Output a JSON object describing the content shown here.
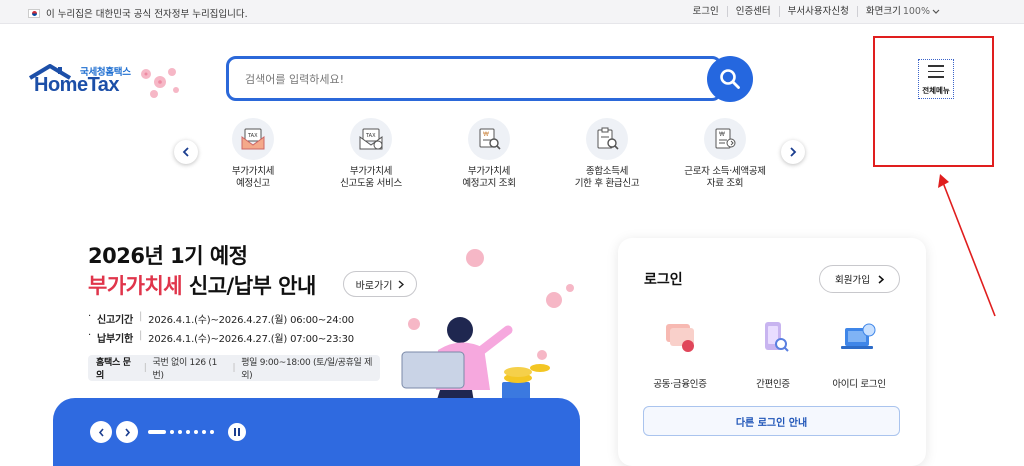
{
  "topbar": {
    "notice": "이 누리집은 대한민국 공식 전자정부 누리집입니다.",
    "links": [
      "로그인",
      "인증센터",
      "부서사용자신청"
    ],
    "zoom_label": "화면크기",
    "zoom_value": "100%"
  },
  "logo": {
    "sub": "국세청홈택스",
    "main": "HomeTax"
  },
  "search": {
    "placeholder": "검색어를 입력하세요!"
  },
  "menu": {
    "label": "전체메뉴"
  },
  "quick_menu": [
    {
      "line1": "부가가치세",
      "line2": "예정신고",
      "icon": "tax-envelope-icon"
    },
    {
      "line1": "부가가치세",
      "line2": "신고도움 서비스",
      "icon": "tax-help-icon"
    },
    {
      "line1": "부가가치세",
      "line2": "예정고지 조회",
      "icon": "notice-search-icon"
    },
    {
      "line1": "종합소득세",
      "line2": "기한 후 환급신고",
      "icon": "clipboard-search-icon"
    },
    {
      "line1": "근로자 소득·세액공제",
      "line2": "자료 조회",
      "icon": "document-won-icon"
    }
  ],
  "banner": {
    "title_line1": "2026년 1기 예정",
    "title_highlight": "부가가치세",
    "title_rest": " 신고/납부 안내",
    "shortcut_label": "바로가기",
    "periods": [
      {
        "label": "신고기간",
        "value": "2026.4.1.(수)~2026.4.27.(월) 06:00~24:00"
      },
      {
        "label": "납부기한",
        "value": "2026.4.1.(수)~2026.4.27.(월) 07:00~23:30"
      }
    ],
    "inquiry_label": "홈택스 문의",
    "inquiry_phone": "국번 없이 126 (1번)",
    "inquiry_hours": "평일 9:00~18:00 (토/일/공휴일 제외)"
  },
  "login": {
    "title": "로그인",
    "signup_label": "회원가입",
    "methods": [
      {
        "label": "공동·금융인증",
        "icon": "certificate-icon"
      },
      {
        "label": "간편인증",
        "icon": "phone-auth-icon"
      },
      {
        "label": "아이디 로그인",
        "icon": "id-login-icon"
      }
    ],
    "other_label": "다른 로그인 안내"
  },
  "colors": {
    "accent": "#2567df",
    "highlight_red": "#e01e1e",
    "banner_red": "#e0354b"
  }
}
